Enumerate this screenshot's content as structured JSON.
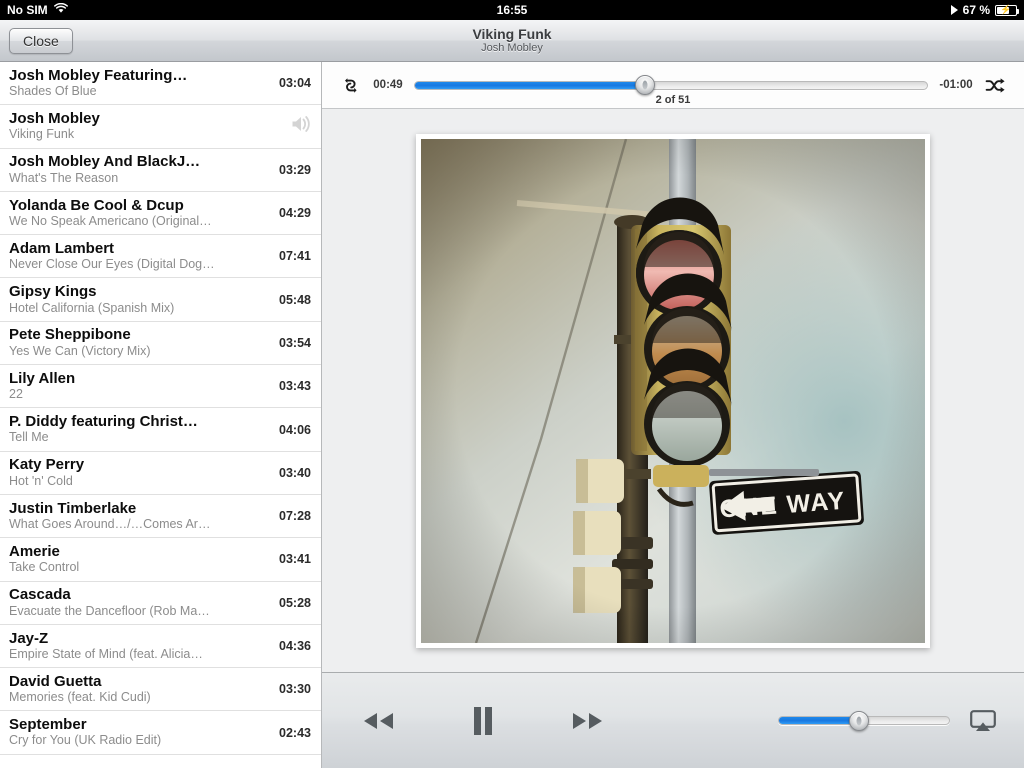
{
  "statusbar": {
    "carrier": "No SIM",
    "wifi_icon": "wifi-icon",
    "time": "16:55",
    "play_icon": "play-indicator-icon",
    "battery_percent": "67 %",
    "battery_icon": "battery-charging-icon",
    "battery_level": 67
  },
  "navbar": {
    "close_label": "Close",
    "title": "Viking Funk",
    "subtitle": "Josh Mobley"
  },
  "tracklist": [
    {
      "title": "Josh Mobley Featuring…",
      "subtitle": "Shades Of Blue",
      "duration": "03:04",
      "now_playing": false
    },
    {
      "title": "Josh Mobley",
      "subtitle": "Viking Funk",
      "duration": "",
      "now_playing": true
    },
    {
      "title": "Josh Mobley And BlackJ…",
      "subtitle": "What's The Reason",
      "duration": "03:29",
      "now_playing": false
    },
    {
      "title": "Yolanda Be Cool & Dcup",
      "subtitle": "We No Speak Americano (Original…",
      "duration": "04:29",
      "now_playing": false
    },
    {
      "title": "Adam Lambert",
      "subtitle": "Never Close Our Eyes (Digital Dog…",
      "duration": "07:41",
      "now_playing": false
    },
    {
      "title": "Gipsy Kings",
      "subtitle": "Hotel California (Spanish Mix)",
      "duration": "05:48",
      "now_playing": false
    },
    {
      "title": "Pete Sheppibone",
      "subtitle": "Yes We Can (Victory Mix)",
      "duration": "03:54",
      "now_playing": false
    },
    {
      "title": "Lily Allen",
      "subtitle": "22",
      "duration": "03:43",
      "now_playing": false
    },
    {
      "title": "P. Diddy featuring Christ…",
      "subtitle": "Tell Me",
      "duration": "04:06",
      "now_playing": false
    },
    {
      "title": "Katy Perry",
      "subtitle": "Hot 'n' Cold",
      "duration": "03:40",
      "now_playing": false
    },
    {
      "title": "Justin Timberlake",
      "subtitle": "What Goes Around…/…Comes Ar…",
      "duration": "07:28",
      "now_playing": false
    },
    {
      "title": "Amerie",
      "subtitle": "Take Control",
      "duration": "03:41",
      "now_playing": false
    },
    {
      "title": "Cascada",
      "subtitle": "Evacuate the Dancefloor (Rob Ma…",
      "duration": "05:28",
      "now_playing": false
    },
    {
      "title": "Jay-Z",
      "subtitle": "Empire State of Mind (feat. Alicia…",
      "duration": "04:36",
      "now_playing": false
    },
    {
      "title": "David Guetta",
      "subtitle": "Memories (feat. Kid Cudi)",
      "duration": "03:30",
      "now_playing": false
    },
    {
      "title": "September",
      "subtitle": "Cry for You (UK Radio Edit)",
      "duration": "02:43",
      "now_playing": false
    }
  ],
  "player": {
    "repeat_icon": "repeat-icon",
    "shuffle_icon": "shuffle-icon",
    "elapsed": "00:49",
    "remaining": "-01:00",
    "progress_percent": 45,
    "track_counter": "2 of 51",
    "artwork_alt": "traffic-light-one-way-album-art",
    "artwork_sign_text": "ONE WAY",
    "rewind_icon": "rewind-icon",
    "pause_icon": "pause-icon",
    "forward_icon": "fast-forward-icon",
    "volume_percent": 47,
    "airplay_icon": "airplay-icon"
  },
  "colors": {
    "accent_blue": "#1f8aeb",
    "nav_gray": "#d3d6da",
    "list_bg": "#ffffff",
    "panel_bg": "#eceded"
  }
}
